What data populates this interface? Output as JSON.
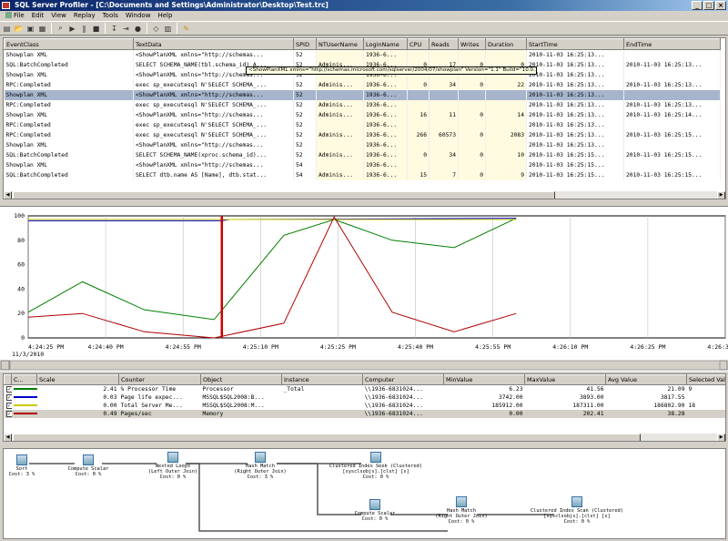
{
  "window": {
    "title": "SQL Server Profiler - [C:\\Documents and Settings\\Administrator\\Desktop\\Test.trc]",
    "buttons": [
      "_",
      "□",
      "×"
    ]
  },
  "menu": [
    "File",
    "Edit",
    "View",
    "Replay",
    "Tools",
    "Window",
    "Help"
  ],
  "toolbar": {
    "icons": [
      "new-trace-icon",
      "open-icon",
      "save-icon",
      "properties-icon",
      "find-icon",
      "start-icon",
      "pause-icon",
      "stop-icon",
      "step-icon",
      "run-to-cursor-icon",
      "breakpoint-icon",
      "clear-icon",
      "options-icon",
      "help-icon"
    ]
  },
  "trace": {
    "columns": [
      "EventClass",
      "TextData",
      "SPID",
      "NTUserName",
      "LoginName",
      "CPU",
      "Reads",
      "Writes",
      "Duration",
      "StartTime",
      "EndTime"
    ],
    "rows": [
      [
        "Showplan XML",
        "<ShowPlanXML xmlns=\"http://schemas...",
        "52",
        "",
        "1936-6...",
        "",
        "",
        "",
        "",
        "2010-11-03 16:25:13...",
        ""
      ],
      [
        "SQL:BatchCompleted",
        "SELECT SCHEMA_NAME(tbl.schema_id) A...",
        "52",
        "Adminis...",
        "1936-6...",
        "0",
        "17",
        "0",
        "0",
        "2010-11-03 16:25:13...",
        "2010-11-03 16:25:13..."
      ],
      [
        "Showplan XML",
        "<ShowPlanXML xmlns=\"http://schemas...",
        "52",
        "",
        "1936-6...",
        "",
        "",
        "",
        "",
        "2010-11-03 16:25:13...",
        ""
      ],
      [
        "RPC:Completed",
        "exec sp_executesql N'SELECT SCHEMA_...",
        "52",
        "Adminis...",
        "1936-6...",
        "0",
        "34",
        "0",
        "22",
        "2010-11-03 16:25:13...",
        "2010-11-03 16:25:13..."
      ],
      [
        "Showplan XML",
        "<ShowPlanXML xmlns=\"http://schemas...",
        "52",
        "",
        "1936-6...",
        "",
        "",
        "",
        "",
        "2010-11-03 16:25:13...",
        ""
      ],
      [
        "RPC:Completed",
        "exec sp_executesql N'SELECT SCHEMA_...",
        "52",
        "Adminis...",
        "1936-6...",
        "",
        "",
        "",
        "",
        "2010-11-03 16:25:13...",
        "2010-11-03 16:25:13..."
      ],
      [
        "Showplan XML",
        "<ShowPlanXML xmlns=\"http://schemas...",
        "52",
        "Adminis...",
        "1936-6...",
        "16",
        "11",
        "0",
        "14",
        "2010-11-03 16:25:13...",
        "2010-11-03 16:25:14..."
      ],
      [
        "RPC:Completed",
        "exec sp_executesql N'SELECT SCHEMA_...",
        "52",
        "",
        "1936-6...",
        "",
        "",
        "",
        "",
        "2010-11-03 16:25:13...",
        ""
      ],
      [
        "RPC:Completed",
        "exec sp_executesql N'SELECT SCHEMA_...",
        "52",
        "Adminis...",
        "1936-6...",
        "266",
        "60573",
        "0",
        "2083",
        "2010-11-03 16:25:13...",
        "2010-11-03 16:25:15..."
      ],
      [
        "Showplan XML",
        "<ShowPlanXML xmlns=\"http://schemas...",
        "52",
        "",
        "1936-6...",
        "",
        "",
        "",
        "",
        "2010-11-03 16:25:13...",
        ""
      ],
      [
        "SQL:BatchCompleted",
        "SELECT SCHEMA_NAME(xproc.schema_id)...",
        "52",
        "Adminis...",
        "1936-6...",
        "0",
        "34",
        "0",
        "10",
        "2010-11-03 16:25:15...",
        "2010-11-03 16:25:15..."
      ],
      [
        "Showplan XML",
        "<ShowPlanXML xmlns=\"http://schemas...",
        "54",
        "",
        "1936-6...",
        "",
        "",
        "",
        "",
        "2010-11-03 16:25:15...",
        ""
      ],
      [
        "SQL:BatchCompleted",
        "SELECT dtb.name AS [Name], dtb.stat...",
        "54",
        "Adminis...",
        "1936-6...",
        "15",
        "7",
        "0",
        "9",
        "2010-11-03 16:25:15...",
        "2010-11-03 16:25:15..."
      ]
    ],
    "selected_row": 4,
    "tooltip": "<ShowPlanXML xmlns=\"http://schemas.microsoft.com/sqlserver/2004/07/showplan\" Version=\"1.1\" Build=\"10.0.1600.22\"><BatchSequence>"
  },
  "chart_data": {
    "type": "line",
    "x": [
      "4:24:25 PM",
      "4:24:40 PM",
      "4:24:55 PM",
      "4:25:10 PM",
      "4:25:25 PM",
      "4:25:40 PM",
      "4:25:55 PM",
      "4:26:10 PM",
      "4:26:25 PM",
      "4:26:39 PM"
    ],
    "x_secondary_label": "11/3/2010",
    "ylim": [
      0,
      100
    ],
    "yticks": [
      0,
      20,
      40,
      60,
      80,
      100
    ],
    "series": [
      {
        "name": "% Processor Time",
        "color": "#008000",
        "points": [
          [
            0,
            21
          ],
          [
            0.7,
            46
          ],
          [
            1.5,
            23
          ],
          [
            2.4,
            15
          ],
          [
            3.3,
            84
          ],
          [
            3.95,
            97
          ],
          [
            4.7,
            80
          ],
          [
            5.5,
            74
          ],
          [
            6.3,
            98
          ]
        ]
      },
      {
        "name": "Page life expectancy",
        "color": "#0000cc",
        "points": [
          [
            0,
            96
          ],
          [
            2.5,
            96
          ],
          [
            2.6,
            97
          ],
          [
            6.3,
            98
          ]
        ]
      },
      {
        "name": "Total Server Memory",
        "color": "#c8c800",
        "points": [
          [
            0,
            97
          ],
          [
            6.3,
            97
          ]
        ]
      },
      {
        "name": "Pages/sec",
        "color": "#b00000",
        "points": [
          [
            0,
            17
          ],
          [
            0.7,
            20
          ],
          [
            1.5,
            5
          ],
          [
            2.4,
            0
          ],
          [
            3.3,
            12
          ],
          [
            3.95,
            99
          ],
          [
            4.7,
            21
          ],
          [
            5.5,
            5
          ],
          [
            6.3,
            20
          ]
        ]
      }
    ],
    "cursor_x": 2.5,
    "grid": "vertical"
  },
  "counters": {
    "columns": [
      "",
      "C...",
      "Scale",
      "Counter",
      "Object",
      "Instance",
      "Computer",
      "MinValue",
      "MaxValue",
      "Avg Value",
      "Selected Valu"
    ],
    "rows": [
      {
        "color": "#008000",
        "scale": "2.41",
        "counter": "% Processor Time",
        "object": "Processor",
        "instance": "_Total",
        "computer": "\\\\1936-6831024...",
        "min": "6.23",
        "max": "41.56",
        "avg": "21.09",
        "sel": "9"
      },
      {
        "color": "#0000cc",
        "scale": "0.03",
        "counter": "Page life expec...",
        "object": "MSSQL$SQL2008:B...",
        "instance": "",
        "computer": "\\\\1936-6831024...",
        "min": "3742.00",
        "max": "3893.00",
        "avg": "3817.55",
        "sel": ""
      },
      {
        "color": "#c8c800",
        "scale": "0.00",
        "counter": "Total Server Me...",
        "object": "MSSQL$SQL2008:M...",
        "instance": "",
        "computer": "\\\\1936-6831024...",
        "min": "185912.00",
        "max": "187311.00",
        "avg": "186802.90",
        "sel": "18"
      },
      {
        "color": "#b00000",
        "scale": "0.49",
        "counter": "Pages/sec",
        "object": "Memory",
        "instance": "",
        "computer": "\\\\1936-6831024...",
        "min": "0.00",
        "max": "202.41",
        "avg": "38.28",
        "sel": ""
      }
    ]
  },
  "plan": {
    "nodes": [
      {
        "label": "Sort",
        "cost": "Cost: 3 %"
      },
      {
        "label": "Compute Scalar",
        "cost": "Cost: 0 %"
      },
      {
        "label": "Nested Loops\n(Left Outer Join)",
        "cost": "Cost: 0 %"
      },
      {
        "label": "Hash Match\n(Right Outer Join)",
        "cost": "Cost: 3 %"
      },
      {
        "label": "Clustered Index Seek (Clustered)\n[sysclsobjs].[clst] [s]",
        "cost": "Cost: 0 %"
      },
      {
        "label": "Compute Scalar",
        "cost": "Cost: 0 %"
      },
      {
        "label": "Hash Match\n(Right Outer Join)",
        "cost": "Cost: 0 %"
      },
      {
        "label": "Clustered Index Scan (Clustered)\n[sysclsobjs].[clst] [s]",
        "cost": "Cost: 0 %"
      }
    ]
  }
}
